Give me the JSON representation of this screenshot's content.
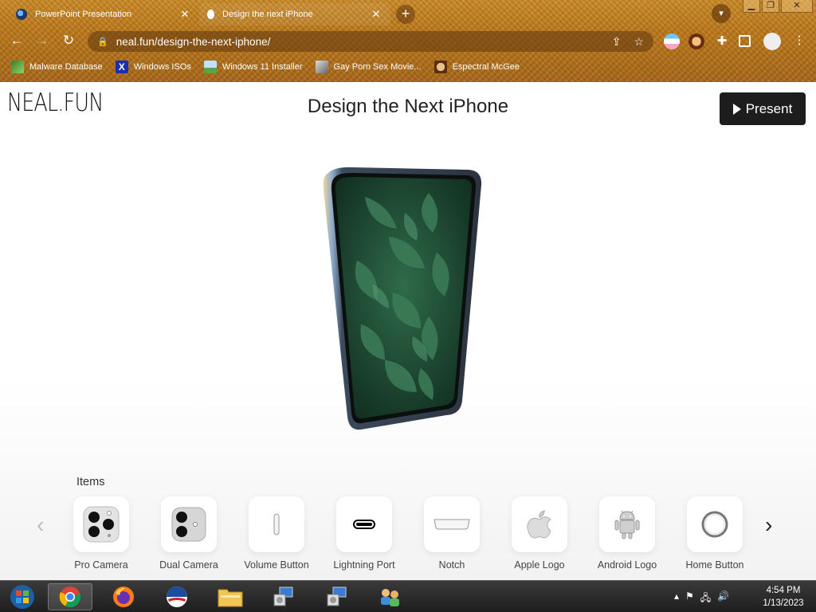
{
  "browser": {
    "tabs": [
      {
        "title": "PowerPoint Presentation",
        "close": "✕"
      },
      {
        "title": "Design the next iPhone",
        "close": "✕"
      }
    ],
    "new_tab": "+",
    "url": "neal.fun/design-the-next-iphone/",
    "window_controls": {
      "minimize": "▁",
      "restore": "❐",
      "close": "✕"
    },
    "bookmarks": [
      {
        "label": "Malware Database",
        "icon": "leaf-icon"
      },
      {
        "label": "Windows ISOs",
        "icon": "x-logo-icon"
      },
      {
        "label": "Windows 11 Installer",
        "icon": "picture-icon"
      },
      {
        "label": "Gay Porn Sex Movie...",
        "icon": "install-icon"
      },
      {
        "label": "Espectral McGee",
        "icon": "face-icon"
      }
    ]
  },
  "page": {
    "logo": "NEAL.FUN",
    "title": "Design the Next iPhone",
    "present_label": "Present",
    "items_heading": "Items",
    "items": [
      {
        "label": "Pro Camera",
        "icon": "pro-camera-icon"
      },
      {
        "label": "Dual Camera",
        "icon": "dual-camera-icon"
      },
      {
        "label": "Volume Button",
        "icon": "volume-button-icon"
      },
      {
        "label": "Lightning Port",
        "icon": "lightning-port-icon"
      },
      {
        "label": "Notch",
        "icon": "notch-icon"
      },
      {
        "label": "Apple Logo",
        "icon": "apple-logo-icon"
      },
      {
        "label": "Android Logo",
        "icon": "android-logo-icon"
      },
      {
        "label": "Home Button",
        "icon": "home-button-icon"
      }
    ]
  },
  "taskbar": {
    "apps": [
      "start-orb",
      "chrome",
      "firefox",
      "obama-logo",
      "file-explorer",
      "installer-a",
      "installer-b",
      "network-app"
    ],
    "clock_time": "4:54 PM",
    "clock_date": "1/13/2023"
  },
  "colors": {
    "chrome_frame": "#b9771c",
    "present_button": "#1d1d1d",
    "taskbar": "#2a2a2a"
  }
}
